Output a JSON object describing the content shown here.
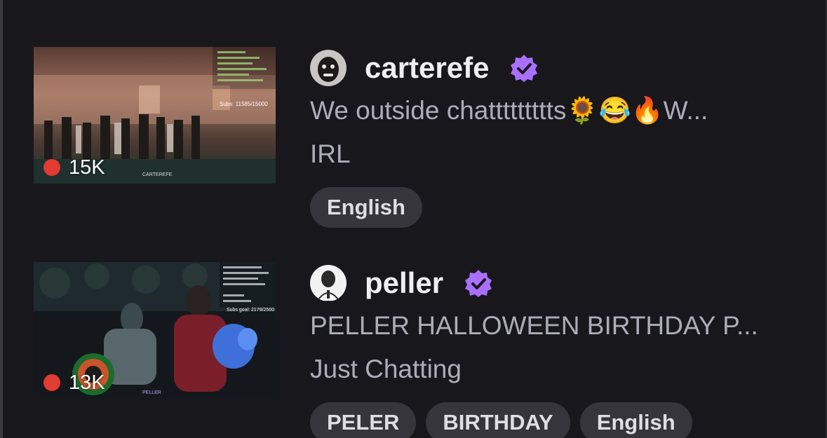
{
  "streams": [
    {
      "channel": "carterefe",
      "title": "We outside chattttttttts🌻😂🔥W...",
      "category": "IRL",
      "viewers": "15K",
      "tags": [
        "English"
      ],
      "thumbnail_overlay": {
        "subs": "Subs: 11585/15000",
        "watermark": "CARTEREFE"
      }
    },
    {
      "channel": "peller",
      "title": "PELLER HALLOWEEN BIRTHDAY P...",
      "category": "Just Chatting",
      "viewers": "13K",
      "tags": [
        "PELER",
        "BIRTHDAY",
        "English"
      ],
      "thumbnail_overlay": {
        "subs": "Subs goal: 2179/2500",
        "watermark": "PELLER"
      }
    }
  ],
  "colors": {
    "background": "#18171c",
    "verified_badge": "#a970ff",
    "live_dot": "#e23b33",
    "tag_bg": "#35353b"
  },
  "icons": {
    "verified": "verified-badge-icon",
    "live": "live-dot-icon"
  }
}
